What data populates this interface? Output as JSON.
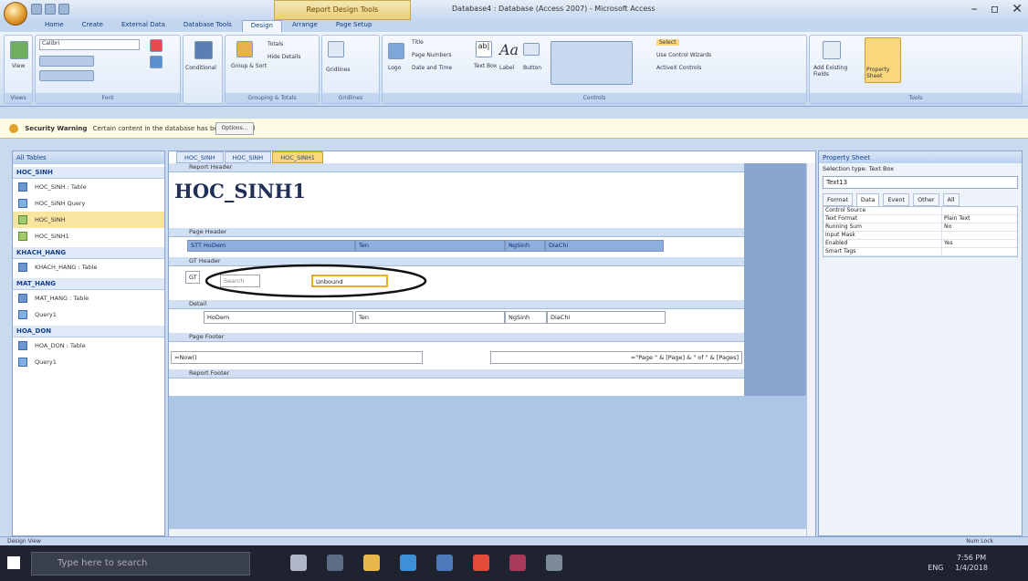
{
  "window": {
    "context_tab": "Report Design Tools",
    "title": "Database4 : Database (Access 2007) - Microsoft Access",
    "buttons": [
      "–",
      "▫",
      "✕"
    ]
  },
  "ribbon_tabs": [
    "Home",
    "Create",
    "External Data",
    "Database Tools",
    "Design",
    "Arrange",
    "Page Setup"
  ],
  "ribbon_active": "Design",
  "ribbon": {
    "views": "Views",
    "view_label": "View",
    "font_group": "Font",
    "font_name": "Calibri",
    "conditional": "Conditional",
    "grouping_group": "Grouping & Totals",
    "group_sort": "Group & Sort",
    "totals": "Totals",
    "hide_details": "Hide Details",
    "gridlines_group": "Gridlines",
    "gridlines": "Gridlines",
    "logo": "Logo",
    "title": "Title",
    "page_numbers": "Page Numbers",
    "date_time": "Date and Time",
    "text_box": "Text Box",
    "label": "Label",
    "button": "Button",
    "controls_group": "Controls",
    "select": "Select",
    "use_wizards": "Use Control Wizards",
    "activex": "ActiveX Controls",
    "add_fields": "Add Existing Fields",
    "property_sheet": "Property Sheet",
    "tools_group": "Tools"
  },
  "security": {
    "label": "Security Warning",
    "text": "Certain content in the database has been disabled",
    "options": "Options..."
  },
  "nav": {
    "header": "All Tables",
    "groups": [
      {
        "name": "HOC_SINH",
        "items": [
          {
            "label": "HOC_SINH : Table",
            "icon": "table-icon"
          },
          {
            "label": "HOC_SINH Query",
            "icon": "query-icon"
          },
          {
            "label": "HOC_SINH",
            "icon": "form-icon",
            "selected": true
          },
          {
            "label": "HOC_SINH1",
            "icon": "report-icon"
          }
        ]
      },
      {
        "name": "KHACH_HANG",
        "items": [
          {
            "label": "KHACH_HANG : Table",
            "icon": "table-icon"
          }
        ]
      },
      {
        "name": "MAT_HANG",
        "items": [
          {
            "label": "MAT_HANG : Table",
            "icon": "table-icon"
          },
          {
            "label": "Query1",
            "icon": "query-icon"
          }
        ]
      },
      {
        "name": "HOA_DON",
        "items": [
          {
            "label": "HOA_DON : Table",
            "icon": "table-icon"
          },
          {
            "label": "Query1",
            "icon": "query-icon"
          }
        ]
      }
    ]
  },
  "doc_tabs": [
    "HOC_SINH",
    "HOC_SINH",
    "HOC_SINH1"
  ],
  "report": {
    "report_header": "Report Header",
    "title": "HOC_SINH1",
    "page_header": "Page Header",
    "ph_fields": [
      "STT HoDem",
      "Ten",
      "NgSinh",
      "DiaChi"
    ],
    "group_header": "GT Header",
    "gt_label": "GT",
    "search": "Search",
    "unbound": "Unbound",
    "detail": "Detail",
    "detail_fields": [
      "HoDem",
      "Ten",
      "NgSinh",
      "DiaChi"
    ],
    "page_footer": "Page Footer",
    "now": "=Now()",
    "page_expr": "=\"Page \" & [Page] & \" of \" & [Pages]",
    "report_footer": "Report Footer"
  },
  "property_sheet": {
    "title": "Property Sheet",
    "selection_type": "Selection type: Text Box",
    "selected_control": "Text13",
    "tabs": [
      "Format",
      "Data",
      "Event",
      "Other",
      "All"
    ],
    "active_tab": "Data",
    "rows": [
      {
        "k": "Control Source",
        "v": ""
      },
      {
        "k": "Text Format",
        "v": "Plain Text"
      },
      {
        "k": "Running Sum",
        "v": "No"
      },
      {
        "k": "Input Mask",
        "v": ""
      },
      {
        "k": "Enabled",
        "v": "Yes"
      },
      {
        "k": "Smart Tags",
        "v": ""
      }
    ]
  },
  "status": {
    "left": "Design View",
    "right": "Num Lock"
  },
  "taskbar": {
    "search_placeholder": "Type here to search",
    "time": "7:56 PM",
    "date": "1/4/2018",
    "lang": "ENG"
  }
}
